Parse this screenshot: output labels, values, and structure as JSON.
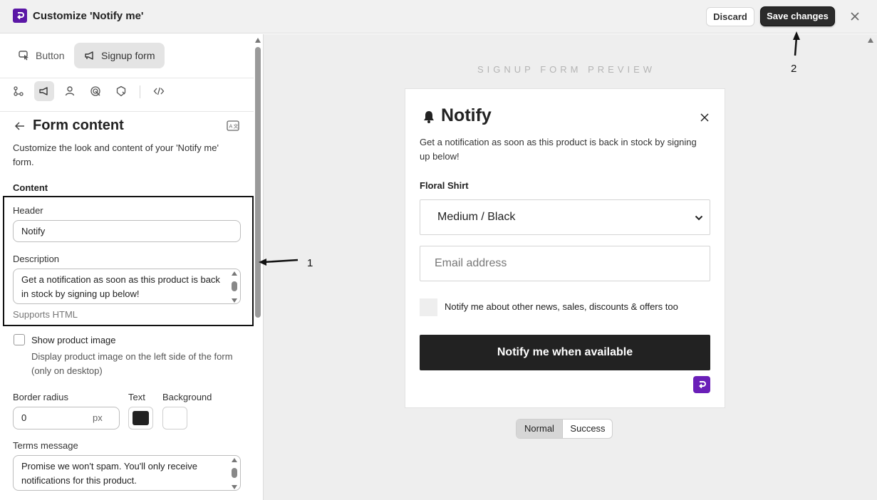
{
  "header": {
    "title": "Customize 'Notify me'",
    "discard_label": "Discard",
    "save_label": "Save changes"
  },
  "tabs": [
    {
      "label": "Button"
    },
    {
      "label": "Signup form"
    }
  ],
  "icon_row": [
    "flow-icon",
    "megaphone-icon",
    "user-icon",
    "target-icon",
    "badge-icon",
    "code-icon"
  ],
  "panel": {
    "title": "Form content",
    "description": "Customize the look and content of your 'Notify me' form.",
    "content_label": "Content",
    "header_label": "Header",
    "header_value": "Notify",
    "description_label": "Description",
    "description_value": "Get a notification as soon as this product is back in stock by signing up below!",
    "supports_html": "Supports HTML",
    "show_product_image_label": "Show product image",
    "show_product_image_desc": "Display product image on the left side of the form (only on desktop)",
    "show_product_image_checked": false,
    "border_radius_label": "Border radius",
    "border_radius_value": "0",
    "border_radius_unit": "px",
    "text_color_label": "Text",
    "text_color": "#222222",
    "background_label": "Background",
    "background_color": "#ffffff",
    "terms_label": "Terms message",
    "terms_value": "Promise we won't spam. You'll only receive notifications for this product."
  },
  "preview": {
    "caption": "SIGNUP FORM PREVIEW",
    "title": "Notify",
    "description": "Get a notification as soon as this product is back in stock by signing up below!",
    "product_name": "Floral Shirt",
    "variant_selected": "Medium / Black",
    "email_placeholder": "Email address",
    "optin_label": "Notify me about other news, sales, discounts & offers too",
    "cta_label": "Notify me when available",
    "states": [
      "Normal",
      "Success"
    ],
    "active_state": "Normal"
  },
  "annotations": {
    "one": "1",
    "two": "2"
  },
  "colors": {
    "brand": "#5b17a6",
    "cta_bg": "#222222",
    "preview_bg": "#eeeeee"
  }
}
